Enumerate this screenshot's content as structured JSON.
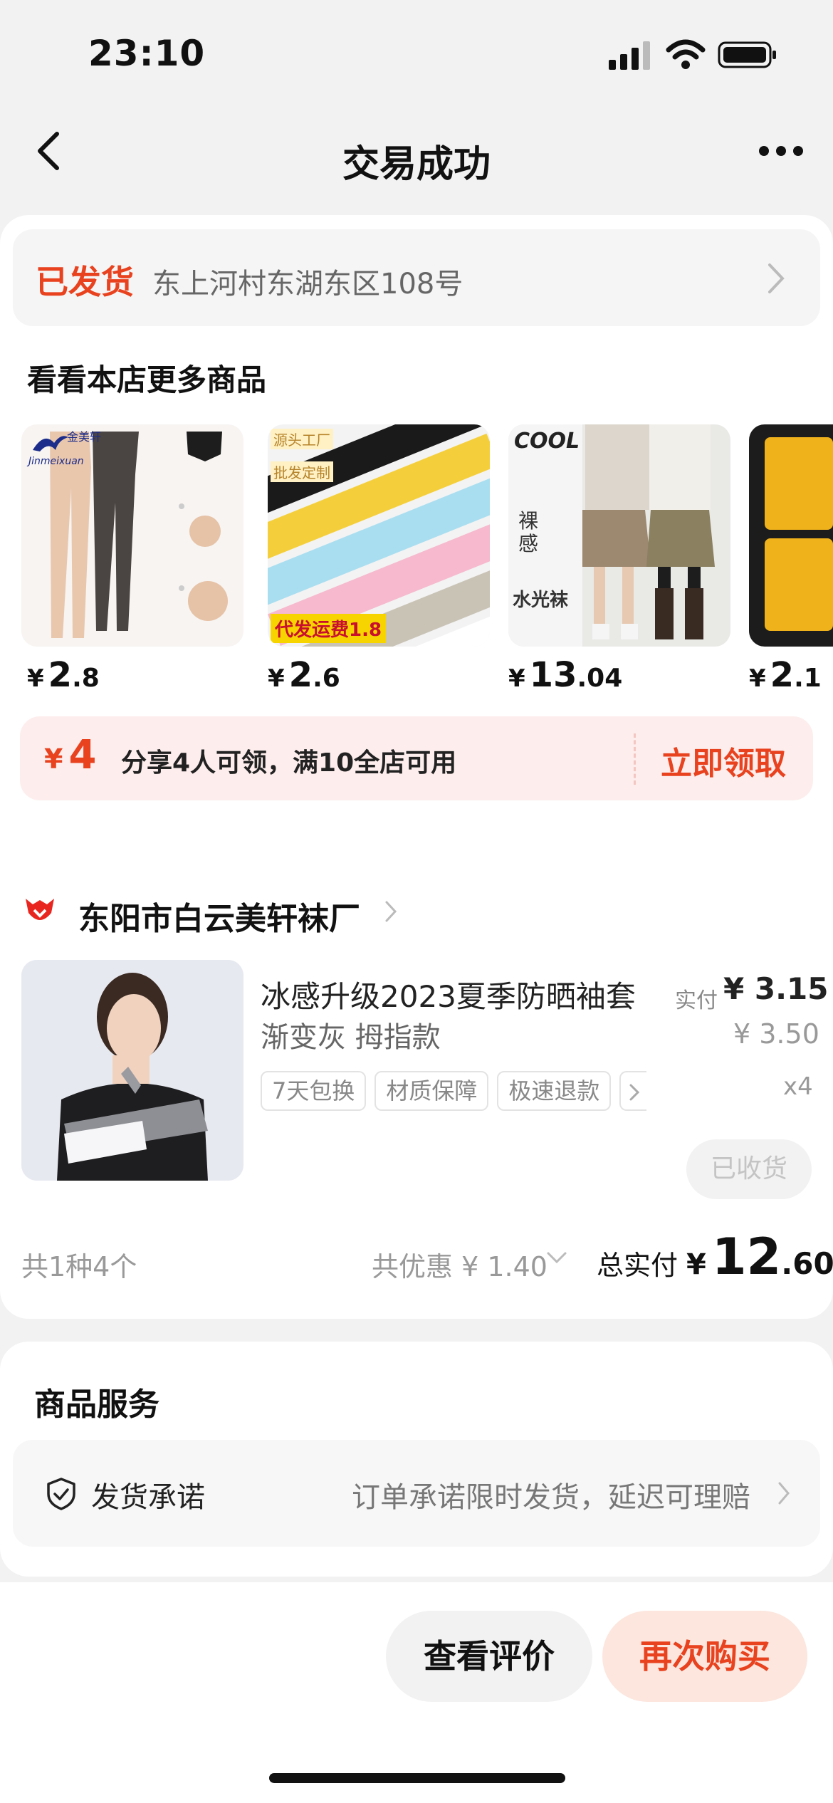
{
  "status_bar": {
    "time": "23:10"
  },
  "nav": {
    "title": "交易成功"
  },
  "shipping": {
    "status": "已发货",
    "address": "东上河村东湖东区108号"
  },
  "more_products": {
    "title": "看看本店更多商品",
    "items": [
      {
        "yen": "¥",
        "int": "2",
        "dec": ".8"
      },
      {
        "yen": "¥",
        "int": "2",
        "dec": ".6"
      },
      {
        "yen": "¥",
        "int": "13",
        "dec": ".04"
      },
      {
        "yen": "¥",
        "int": "2",
        "dec": ".1"
      }
    ],
    "thumb_text": {
      "brand": "Jinmeixuan",
      "brand_cn": "金美轩",
      "tag1": "源头工厂",
      "tag2": "批发定制",
      "ship_fee": "代发运费1.8",
      "cool": "COOL",
      "luo": "裸感",
      "shuiguang": "水光袜"
    }
  },
  "coupon": {
    "yen": "¥",
    "amount": "4",
    "text": "分享4人可领，满10全店可用",
    "button": "立即领取"
  },
  "shop": {
    "name": "东阳市白云美轩袜厂"
  },
  "order_item": {
    "title": "冰感升级2023夏季防晒袖套",
    "spec": "渐变灰 拇指款",
    "tags": [
      "7天包换",
      "材质保障",
      "极速退款"
    ],
    "paid_label": "实付",
    "paid_value": "¥ 3.15",
    "original_price": "¥ 3.50",
    "quantity": "x4",
    "status_button": "已收货"
  },
  "summary": {
    "count": "共1种4个",
    "discount": "共优惠 ¥ 1.40",
    "total_label": "总实付",
    "total_yen": "¥",
    "total_int": "12",
    "total_dec": ".60"
  },
  "service": {
    "title": "商品服务",
    "label": "发货承诺",
    "desc": "订单承诺限时发货，延迟可理赔"
  },
  "actions": {
    "review": "查看评价",
    "rebuy": "再次购买"
  },
  "colors": {
    "accent": "#e8421f",
    "coupon_bg": "#fdeeed",
    "rebuy_bg": "#fce6de"
  }
}
